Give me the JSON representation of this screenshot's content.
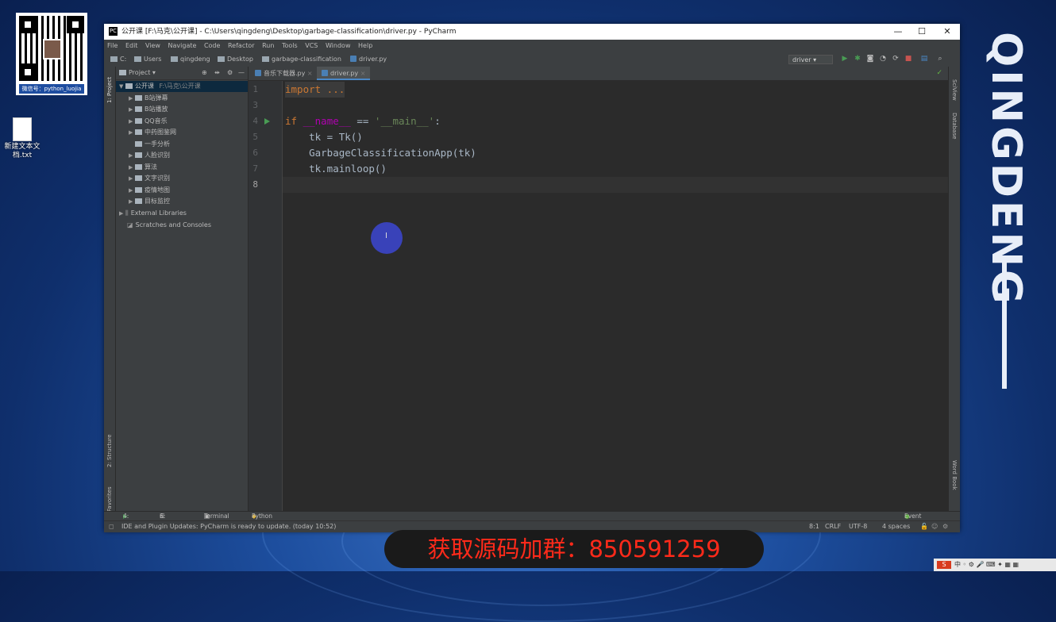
{
  "desktop": {
    "brand_text": "QINGDENG",
    "qr_caption": "微信号：python_luojia",
    "desktop_icon_label": "新建文本文档.txt",
    "banner_text": "获取源码加群：850591259",
    "tray_text": "中 ◦ ⚙ 🎤 ⌨ ✦ ▦ ▦"
  },
  "window": {
    "title": "公开课 [F:\\马克\\公开课] - C:\\Users\\qingdeng\\Desktop\\garbage-classification\\driver.py - PyCharm",
    "controls": [
      "—",
      "☐",
      "✕"
    ]
  },
  "menu": [
    "File",
    "Edit",
    "View",
    "Navigate",
    "Code",
    "Refactor",
    "Run",
    "Tools",
    "VCS",
    "Window",
    "Help"
  ],
  "breadcrumbs": [
    "C:",
    "Users",
    "qingdeng",
    "Desktop",
    "garbage-classification",
    "driver.py"
  ],
  "run_config": "driver",
  "left_strip": {
    "project": "1: Project",
    "structure": "2: Structure",
    "favorites": "2: Favorites"
  },
  "right_strip": {
    "sciview": "SciView",
    "database": "Database",
    "wordbook": "Word Book"
  },
  "project_panel": {
    "header": "Project",
    "root": {
      "name": "公开课",
      "path": "F:\\马克\\公开课"
    },
    "items": [
      "B站弹幕",
      "B站播放",
      "QQ音乐",
      "中药图鉴网",
      "一手分析",
      "人脸识别",
      "算法",
      "文字识别",
      "疫情地图",
      "目标监控"
    ],
    "external": "External Libraries",
    "scratches": "Scratches and Consoles"
  },
  "tabs": [
    {
      "label": "音乐下载器.py",
      "active": false
    },
    {
      "label": "driver.py",
      "active": true
    }
  ],
  "editor": {
    "line_numbers": [
      "1",
      "3",
      "4",
      "5",
      "6",
      "7",
      "8"
    ],
    "code": {
      "l1": "import ...",
      "l4_if": "if",
      "l4_name": "__name__",
      "l4_eq": " == ",
      "l4_str": "'__main__'",
      "l4_colon": ":",
      "l5": "    tk = Tk()",
      "l6": "    GarbageClassificationApp(tk)",
      "l7": "    tk.mainloop()"
    }
  },
  "tool_windows": [
    "4: Run",
    "6: TODO",
    "Terminal",
    "Python Console",
    "Event Log"
  ],
  "status_bar": {
    "message": "IDE and Plugin Updates: PyCharm is ready to update. (today 10:52)",
    "position": "8:1",
    "line_sep": "CRLF",
    "encoding": "UTF-8",
    "indent": "4 spaces"
  }
}
